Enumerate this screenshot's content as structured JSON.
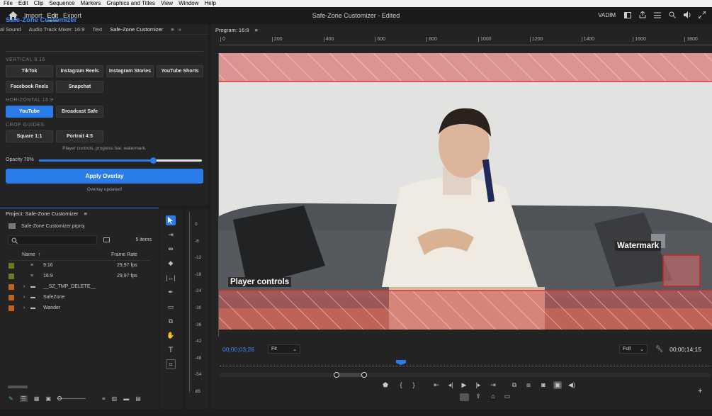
{
  "menubar": [
    "File",
    "Edit",
    "Clip",
    "Sequence",
    "Markers",
    "Graphics and Titles",
    "View",
    "Window",
    "Help"
  ],
  "header": {
    "nav": [
      "Import",
      "Edit",
      "Export"
    ],
    "active_nav": "Edit",
    "title": "Safe-Zone Customizer - Edited",
    "user": "VADIM"
  },
  "left_panel": {
    "tabs": [
      "al Sound",
      "Audio Track Mixer: 16:9",
      "Text",
      "Safe-Zone Customizer"
    ],
    "active_tab": "Safe-Zone Customizer",
    "title": "Safe-Zone Customizer",
    "sections": {
      "vertical": "VERTICAL 9:16",
      "horizontal": "HORIZONTAL 16:9",
      "crop": "CROP GUIDES"
    },
    "vertical_buttons": [
      "TikTok",
      "Instagram Reels",
      "Instagram Stories",
      "YouTube Shorts",
      "Facebook Reels",
      "Snapchat"
    ],
    "horizontal_buttons": [
      "YouTube",
      "Broadcast Safe"
    ],
    "selected_button": "YouTube",
    "crop_buttons": [
      "Square 1:1",
      "Portrait 4:5"
    ],
    "help_text": "Player controls, progress bar, watermark.",
    "opacity_label": "Opacity 70%",
    "opacity_value": 0.7,
    "apply_label": "Apply Overlay",
    "status": "Overlay updated!"
  },
  "project": {
    "title": "Project: Safe-Zone Customizer",
    "file": "Safe-Zone Customizer.prproj",
    "item_count": "5 items",
    "col_name": "Name",
    "col_rate": "Frame Rate",
    "items": [
      {
        "name": "9:16",
        "rate": "29,97 fps",
        "type": "sequence",
        "color": "#6a7a1e"
      },
      {
        "name": "16:9",
        "rate": "29,97 fps",
        "type": "sequence",
        "color": "#6a7a1e"
      },
      {
        "name": "__SZ_TMP_DELETE__",
        "rate": "",
        "type": "bin",
        "color": "#c0631c"
      },
      {
        "name": "SafeZone",
        "rate": "",
        "type": "bin",
        "color": "#c0631c"
      },
      {
        "name": "Wander",
        "rate": "",
        "type": "bin",
        "color": "#c0631c"
      }
    ]
  },
  "meter": {
    "labels": [
      "0",
      "-6",
      "-12",
      "-18",
      "-24",
      "-30",
      "-36",
      "-42",
      "-48",
      "-54",
      "dB"
    ]
  },
  "program": {
    "tab": "Program: 16:9",
    "ruler": [
      "0",
      "200",
      "400",
      "600",
      "800",
      "1000",
      "1200",
      "1400",
      "1600",
      "1800"
    ],
    "overlay_labels": {
      "player_controls": "Player controls",
      "watermark": "Watermark"
    },
    "timecode_current": "00;00;03;26",
    "timecode_duration": "00;00;14;15",
    "fit": "Fit",
    "quality": "Full",
    "playhead_fraction": 0.37
  },
  "colors": {
    "accent": "#2a7de8",
    "title_blue": "#3d8af7",
    "overlay_red": "#e05050"
  }
}
